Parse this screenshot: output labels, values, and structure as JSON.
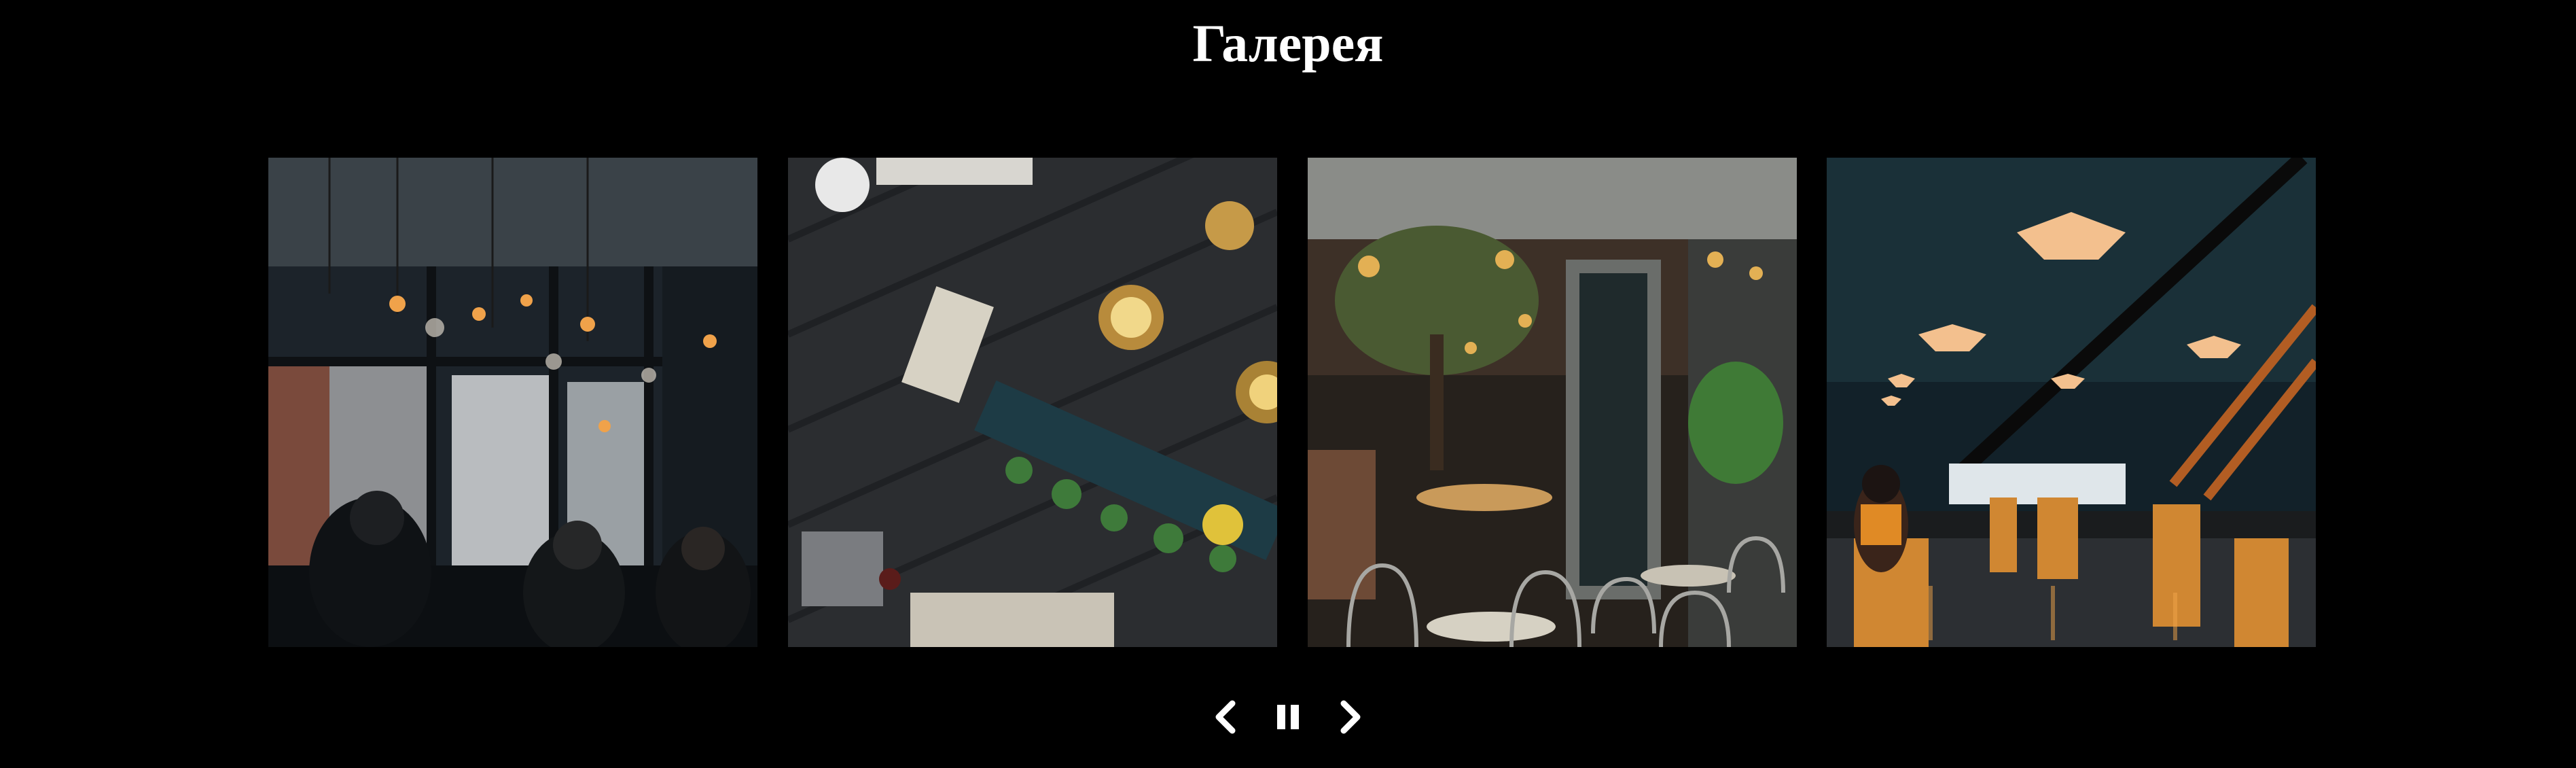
{
  "page": {
    "title": "Галерея",
    "background": "#000000"
  },
  "gallery": {
    "slides": [
      {
        "icon": "cafe-window-photo",
        "alt": ""
      },
      {
        "icon": "cafe-topdown-photo",
        "alt": ""
      },
      {
        "icon": "cafe-terrace-photo",
        "alt": ""
      },
      {
        "icon": "cafe-interior-photo",
        "alt": ""
      }
    ]
  },
  "controls": {
    "prev_icon": "chevron-left-icon",
    "pause_icon": "pause-icon",
    "next_icon": "chevron-right-icon",
    "color": "#ffffff"
  }
}
